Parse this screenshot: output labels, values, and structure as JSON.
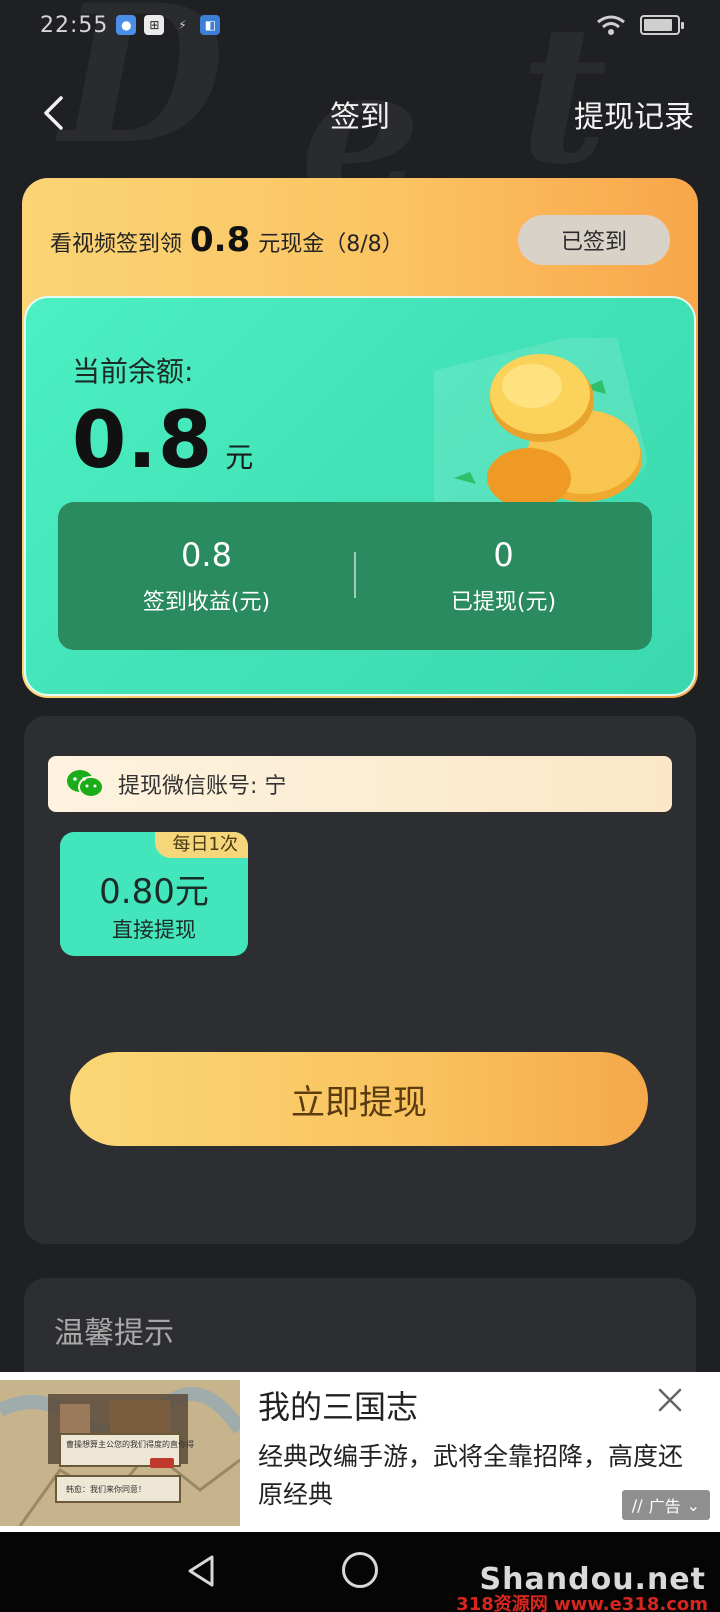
{
  "status_bar": {
    "time": "22:55"
  },
  "nav": {
    "title": "签到",
    "record_link": "提现记录"
  },
  "signin": {
    "prefix": "看视频签到领",
    "amount": "0.8",
    "suffix": "元现金（8/8）",
    "signed_button": "已签到"
  },
  "balance": {
    "label": "当前余额:",
    "value": "0.8",
    "unit": "元",
    "stats": [
      {
        "value": "0.8",
        "label": "签到收益(元)"
      },
      {
        "value": "0",
        "label": "已提现(元)"
      }
    ]
  },
  "withdraw": {
    "wechat_account": "提现微信账号: 宁",
    "option": {
      "badge": "每日1次",
      "amount": "0.80元",
      "label": "直接提现"
    },
    "button": "立即提现"
  },
  "tips": {
    "title": "温馨提示"
  },
  "ad": {
    "title": "我的三国志",
    "description": "经典改编手游，武将全靠招降，高度还原经典",
    "tag": "广告",
    "image_text_1": "曹操想算主公您的我们得度的直你得",
    "image_text_2": "韩愈：我们来你同意！"
  },
  "watermark": {
    "brand": "Shandou.net",
    "site": "318资源网 www.e318.com"
  },
  "colors": {
    "background": "#1f2023",
    "accent_orange": "#f9c35f",
    "accent_green": "#43e6bc",
    "stats_green": "#2b8b60"
  },
  "icons": {
    "back": "chevron-left-icon",
    "wechat": "wechat-icon",
    "close": "close-icon",
    "coins": "coins-icon"
  }
}
